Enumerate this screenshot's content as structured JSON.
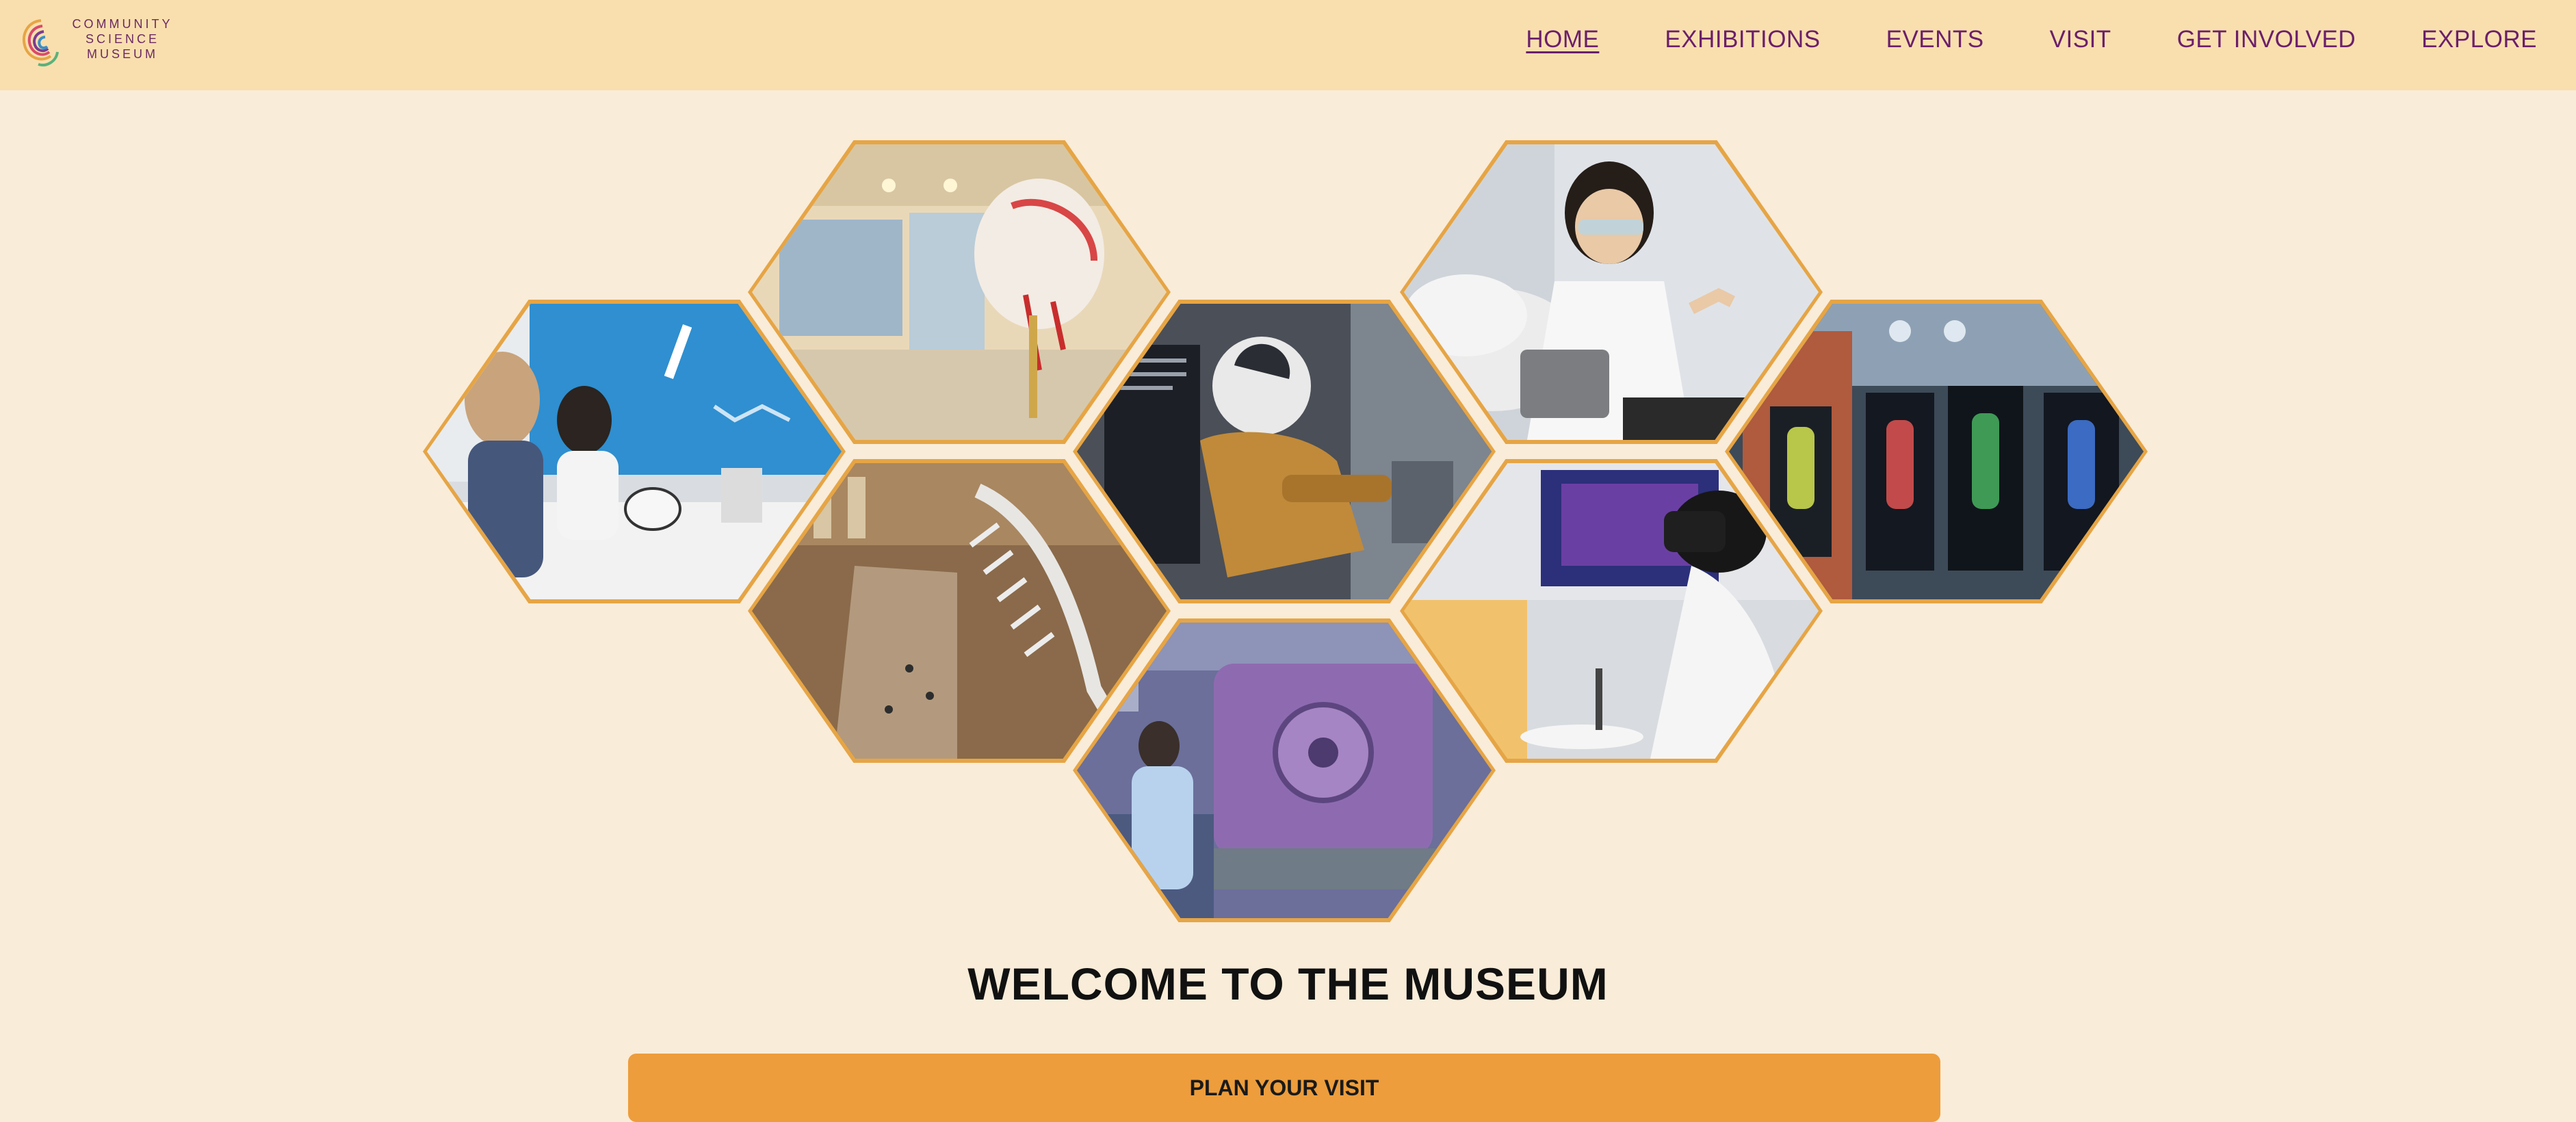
{
  "brand": {
    "line1": "COMMUNITY",
    "line2": "SCIENCE",
    "line3": "MUSEUM",
    "logo_icon": "swirl-logo-icon"
  },
  "nav": [
    {
      "label": "HOME",
      "active": true
    },
    {
      "label": "EXHIBITIONS",
      "active": false
    },
    {
      "label": "EVENTS",
      "active": false
    },
    {
      "label": "VISIT",
      "active": false
    },
    {
      "label": "GET INVOLVED",
      "active": false
    },
    {
      "label": "EXPLORE",
      "active": false
    }
  ],
  "gallery": [
    {
      "name": "women-lab-experiment-photo"
    },
    {
      "name": "anatomy-skull-model-photo"
    },
    {
      "name": "whale-skeleton-hall-photo"
    },
    {
      "name": "astronaut-suit-display-photo"
    },
    {
      "name": "vacuum-chamber-scientist-photo"
    },
    {
      "name": "girl-dry-ice-experiment-photo"
    },
    {
      "name": "vr-headset-visitor-photo"
    },
    {
      "name": "figures-exhibit-hall-photo"
    }
  ],
  "hero": {
    "title": "WELCOME TO THE MUSEUM"
  },
  "cta": {
    "label": "PLAN YOUR VISIT"
  },
  "colors": {
    "page_bg": "#f9ecd9",
    "header_bg": "#f9dfae",
    "nav_text": "#6b1f6b",
    "hex_border": "#e6a545",
    "cta_bg": "#ed9d3c"
  }
}
